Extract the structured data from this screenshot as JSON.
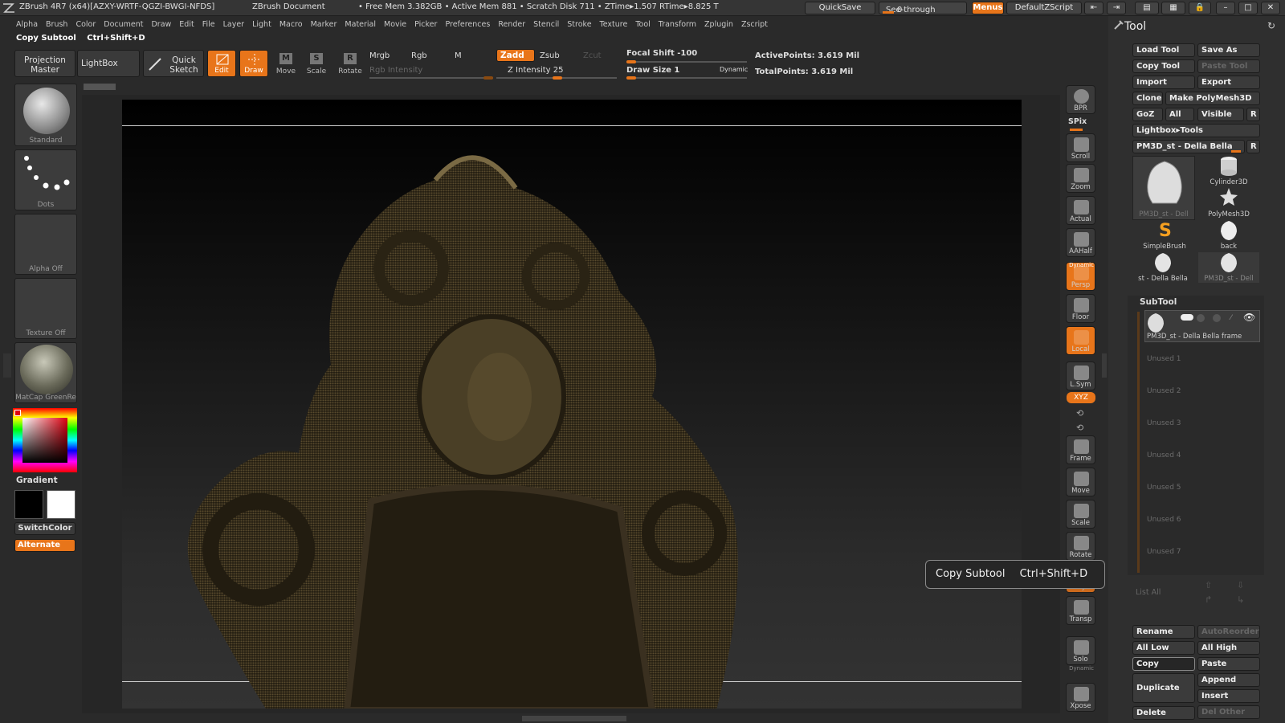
{
  "titlebar": {
    "app_title": "ZBrush 4R7 (x64)[AZXY-WRTF-QGZI-BWGI-NFDS]",
    "document": "ZBrush Document",
    "stats": "• Free Mem 3.382GB • Active Mem 881 • Scratch Disk 711 • ZTime▸1.507 RTime▸8.825 T",
    "quicksave": "QuickSave",
    "see_through_label": "See-through",
    "see_through_value": "0",
    "menus": "Menus",
    "script": "DefaultZScript"
  },
  "menubar": [
    "Alpha",
    "Brush",
    "Color",
    "Document",
    "Draw",
    "Edit",
    "File",
    "Layer",
    "Light",
    "Macro",
    "Marker",
    "Material",
    "Movie",
    "Picker",
    "Preferences",
    "Render",
    "Stencil",
    "Stroke",
    "Texture",
    "Tool",
    "Transform",
    "Zplugin",
    "Zscript"
  ],
  "infobar": {
    "action": "Copy Subtool",
    "shortcut": "Ctrl+Shift+D"
  },
  "shelf": {
    "projection_master": "Projection Master",
    "lightbox": "LightBox",
    "quick_sketch": "Quick Sketch",
    "edit": "Edit",
    "draw": "Draw",
    "move": "Move",
    "scale": "Scale",
    "rotate": "Rotate",
    "mrgb": "Mrgb",
    "rgb": "Rgb",
    "m": "M",
    "rgb_intensity": "Rgb  Intensity",
    "zadd": "Zadd",
    "zsub": "Zsub",
    "zcut": "Zcut",
    "z_intensity": "Z Intensity 25",
    "focal_shift": "Focal Shift -100",
    "draw_size": "Draw Size 1",
    "dynamic": "Dynamic",
    "active_points": "ActivePoints: 3.619  Mil",
    "total_points": "TotalPoints: 3.619  Mil"
  },
  "left_palette": {
    "brush": "Standard",
    "stroke": "Dots",
    "alpha": "Alpha  Off",
    "texture": "Texture  Off",
    "material": "MatCap  GreenRe",
    "gradient": "Gradient",
    "switch_color": "SwitchColor",
    "alternate": "Alternate"
  },
  "right_dock": [
    "BPR",
    "SPix",
    "Scroll",
    "Zoom",
    "Actual",
    "AAHalf",
    "Persp",
    "Floor",
    "Local",
    "L.Sym",
    "Frame",
    "Move",
    "Scale",
    "Rotate",
    "PolyF",
    "Transp",
    "Solo",
    "Xpose"
  ],
  "right_dock_extra": {
    "dynamic": "Dynamic",
    "dynamic_solo": "Dynamic",
    "xyz": "XYZ"
  },
  "tool": {
    "title": "Tool",
    "load_tool": "Load Tool",
    "save_as": "Save As",
    "copy_tool": "Copy Tool",
    "paste_tool": "Paste Tool",
    "import": "Import",
    "export": "Export",
    "clone": "Clone",
    "make_polymesh": "Make PolyMesh3D",
    "goz": "GoZ",
    "all": "All",
    "visible": "Visible",
    "r": "R",
    "lightbox_tools": "Lightbox▸Tools",
    "current_tool": "PM3D_st - Della Bella",
    "thumbs": [
      "PM3D_st - Dell",
      "Cylinder3D",
      "PolyMesh3D",
      "SimpleBrush",
      "back",
      "st - Della Bella",
      "PM3D_st - Dell"
    ]
  },
  "subtool": {
    "title": "SubTool",
    "active": "PM3D_st - Della Bella frame",
    "unused": [
      "Unused 1",
      "Unused 2",
      "Unused 3",
      "Unused 4",
      "Unused 5",
      "Unused 6",
      "Unused 7"
    ],
    "list_all": "List  All",
    "rename": "Rename",
    "auto_reorder": "AutoReorder",
    "all_low": "All Low",
    "all_high": "All High",
    "copy": "Copy",
    "paste": "Paste",
    "duplicate": "Duplicate",
    "append": "Append",
    "insert": "Insert",
    "delete": "Delete",
    "del_other": "Del Other"
  },
  "tooltip": {
    "text": "Copy Subtool",
    "shortcut": "Ctrl+Shift+D"
  },
  "colors": {
    "accent": "#e8751a",
    "panel": "#2f2f2f",
    "button": "#3a3a3a"
  }
}
